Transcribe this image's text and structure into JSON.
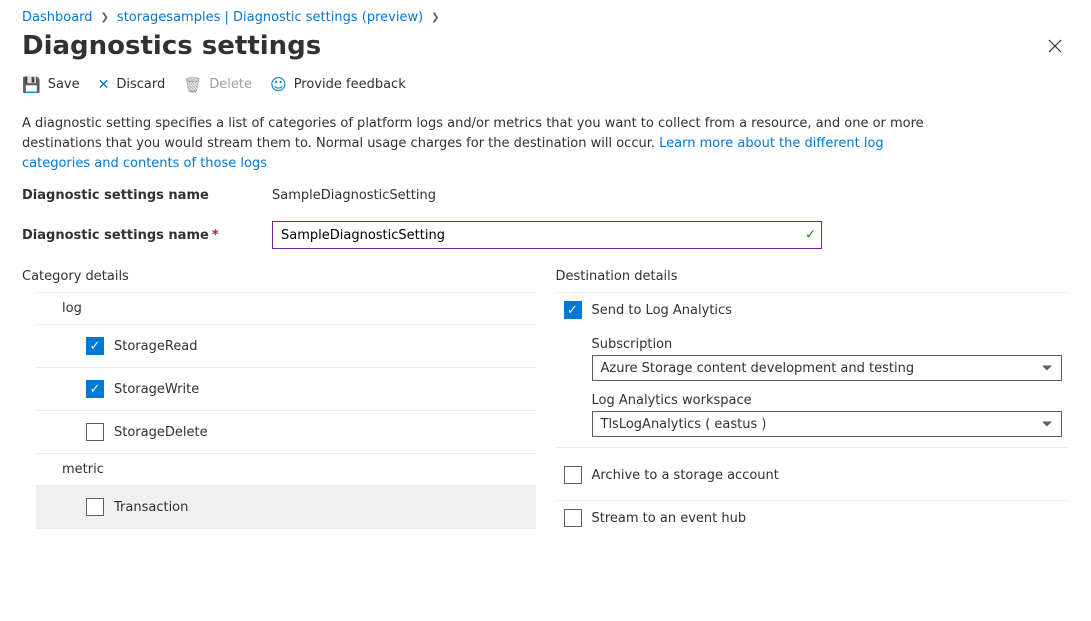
{
  "breadcrumb": {
    "root": "Dashboard",
    "middle": "storagesamples | Diagnostic settings (preview)"
  },
  "title": "Diagnostics settings",
  "toolbar": {
    "save": "Save",
    "discard": "Discard",
    "delete": "Delete",
    "feedback": "Provide feedback"
  },
  "description": {
    "text": "A diagnostic setting specifies a list of categories of platform logs and/or metrics that you want to collect from a resource, and one or more destinations that you would stream them to. Normal usage charges for the destination will occur. ",
    "link": "Learn more about the different log categories and contents of those logs"
  },
  "nameField": {
    "label": "Diagnostic settings name",
    "static_value": "SampleDiagnosticSetting",
    "input_label": "Diagnostic settings name",
    "input_value": "SampleDiagnosticSetting"
  },
  "category": {
    "title": "Category details",
    "log_label": "log",
    "logs": [
      {
        "label": "StorageRead",
        "checked": true
      },
      {
        "label": "StorageWrite",
        "checked": true
      },
      {
        "label": "StorageDelete",
        "checked": false
      }
    ],
    "metric_label": "metric",
    "metrics": [
      {
        "label": "Transaction",
        "checked": false
      }
    ]
  },
  "destination": {
    "title": "Destination details",
    "send_la": {
      "label": "Send to Log Analytics",
      "checked": true
    },
    "subscription_label": "Subscription",
    "subscription_value": "Azure Storage content development and testing",
    "workspace_label": "Log Analytics workspace",
    "workspace_value": "TlsLogAnalytics ( eastus )",
    "archive": {
      "label": "Archive to a storage account",
      "checked": false
    },
    "stream": {
      "label": "Stream to an event hub",
      "checked": false
    }
  }
}
